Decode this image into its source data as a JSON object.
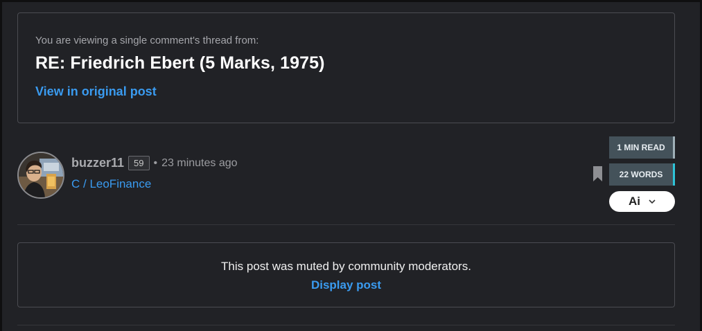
{
  "thread": {
    "intro": "You are viewing a single comment's thread from:",
    "title": "RE: Friedrich Ebert (5 Marks, 1975)",
    "link_label": "View in original post"
  },
  "comment": {
    "author": "buzzer11",
    "reputation": "59",
    "separator": "•",
    "time_ago": "23 minutes ago",
    "community": "C / LeoFinance"
  },
  "meta": {
    "read_time": "1 MIN READ",
    "word_count": "22 WORDS",
    "ai_label": "Ai"
  },
  "muted": {
    "message": "This post was muted by community moderators.",
    "display_label": "Display post"
  },
  "colors": {
    "background": "#212226",
    "link": "#3a9bf0",
    "border": "#4b4c52",
    "badge": "#44525a",
    "words_accent": "#2ec4d8"
  },
  "icons": {
    "bookmark": "bookmark-icon",
    "chevron": "chevron-down-icon",
    "avatar": "user-avatar"
  }
}
